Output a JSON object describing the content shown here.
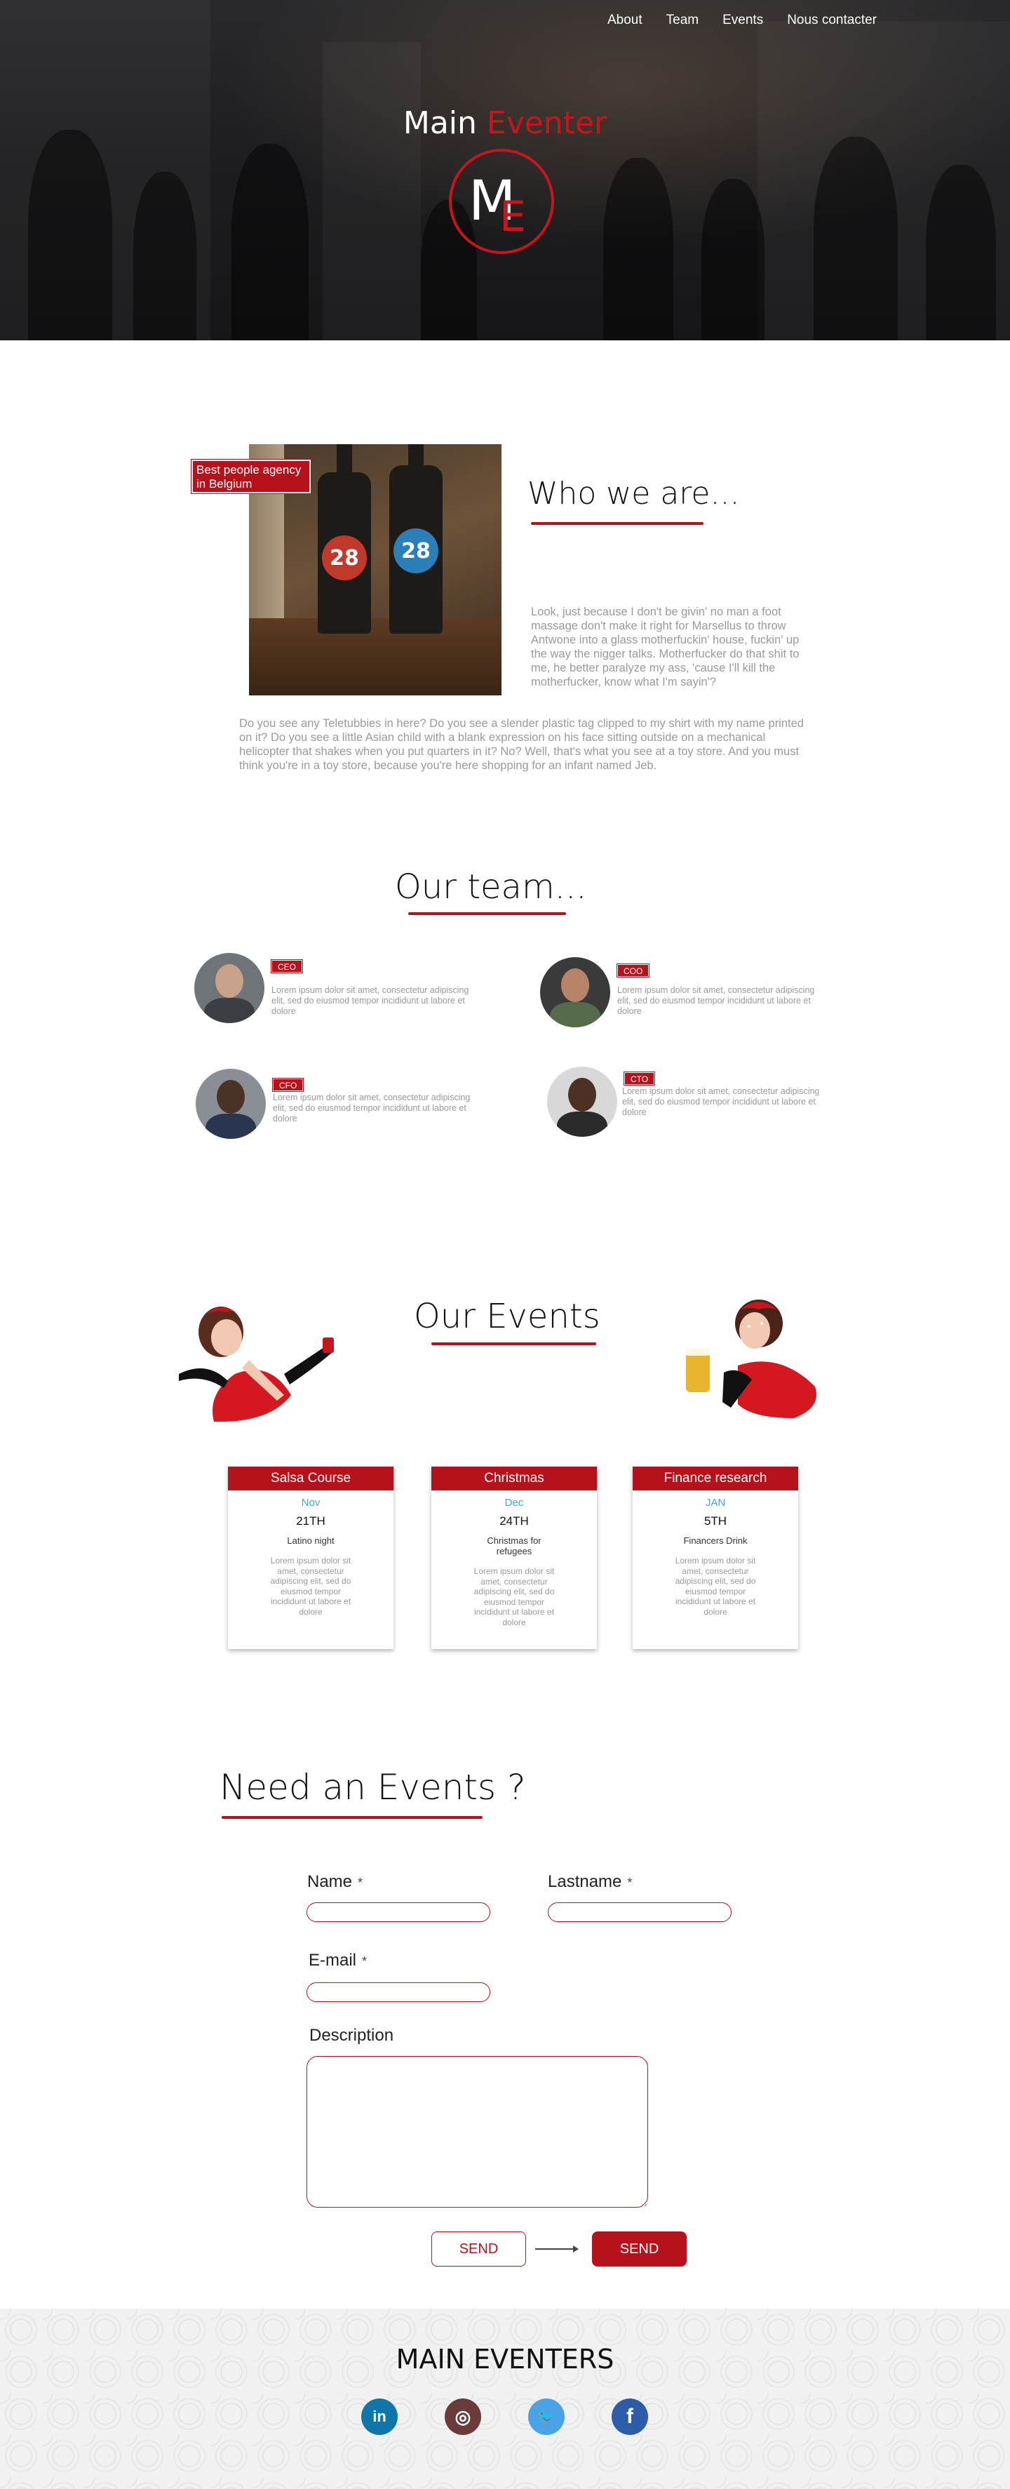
{
  "nav": {
    "items": [
      {
        "label": "About"
      },
      {
        "label": "Team"
      },
      {
        "label": "Events"
      },
      {
        "label": "Nous contacter"
      }
    ]
  },
  "hero": {
    "brand_main": "Main",
    "brand_accent": "Eventer",
    "logo_m": "M",
    "logo_e": "E"
  },
  "about": {
    "heading": "Who we are...",
    "tag": "Best people agency in Belgium",
    "bottle_number": "28",
    "text_right": "Look, just because I don't be givin' no man a foot massage don't make it right for Marsellus to throw Antwone into a glass motherfuckin' house, fuckin' up the way the nigger talks. Motherfucker do that shit to me, he better paralyze my ass, 'cause I'll kill the motherfucker, know what I'm sayin'?",
    "text_bottom": "Do you see any Teletubbies in here? Do you see a slender plastic tag clipped to my shirt with my name printed on it? Do you see a little Asian child with a blank expression on his face sitting outside on a mechanical helicopter that shakes when you put quarters in it? No? Well, that's what you see at a toy store. And you must think you're in a toy store, because you're here shopping for an infant named Jeb."
  },
  "team": {
    "heading": "Our team...",
    "members": [
      {
        "role": "CEO",
        "desc": "Lorem ipsum dolor sit amet, consectetur adipiscing elit, sed do eiusmod tempor incididunt ut labore et dolore"
      },
      {
        "role": "COO",
        "desc": "Lorem ipsum dolor sit amet, consectetur adipiscing elit, sed do eiusmod tempor incididunt ut labore et dolore"
      },
      {
        "role": "CFO",
        "desc": "Lorem ipsum dolor sit amet, consectetur adipiscing elit, sed do eiusmod tempor incididunt ut labore et dolore"
      },
      {
        "role": "CTO",
        "desc": "Lorem ipsum dolor sit amet, consectetur adipiscing elit, sed do eiusmod tempor incididunt ut labore et dolore"
      }
    ]
  },
  "events": {
    "heading": "Our Events",
    "cards": [
      {
        "title": "Salsa Course",
        "month": "Nov",
        "day": "21TH",
        "subtitle": "Latino night",
        "desc": "Lorem ipsum dolor sit amet, consectetur adipiscing elit, sed do eiusmod tempor incididunt ut labore et dolore"
      },
      {
        "title": "Christmas",
        "month": "Dec",
        "day": "24TH",
        "subtitle": "Christmas for refugees",
        "desc": "Lorem ipsum dolor sit amet, consectetur adipiscing elit, sed do eiusmod tempor incididunt ut labore et dolore"
      },
      {
        "title": "Finance research",
        "month": "JAN",
        "day": "5TH",
        "subtitle": "Financers Drink",
        "desc": "Lorem ipsum dolor sit amet, consectetur adipiscing elit, sed do eiusmod tempor incididunt ut labore et dolore"
      }
    ]
  },
  "contact": {
    "heading": "Need an Events ?",
    "name_label": "Name",
    "lastname_label": "Lastname",
    "email_label": "E-mail",
    "description_label": "Description",
    "required_mark": "*",
    "send_outline": "SEND",
    "send_filled": "SEND"
  },
  "footer": {
    "title": "MAIN EVENTERS",
    "social": [
      {
        "icon": "linkedin-icon",
        "glyph": "in",
        "color": "#0e76a8"
      },
      {
        "icon": "instagram-icon",
        "glyph": "◎",
        "color": "#6a3b3a"
      },
      {
        "icon": "twitter-icon",
        "glyph": "🐦",
        "color": "#4aa3e6"
      },
      {
        "icon": "facebook-icon",
        "glyph": "f",
        "color": "#2f5ca8"
      }
    ]
  },
  "colors": {
    "accent": "#b5121b",
    "month_blue": "#45a5dc"
  }
}
